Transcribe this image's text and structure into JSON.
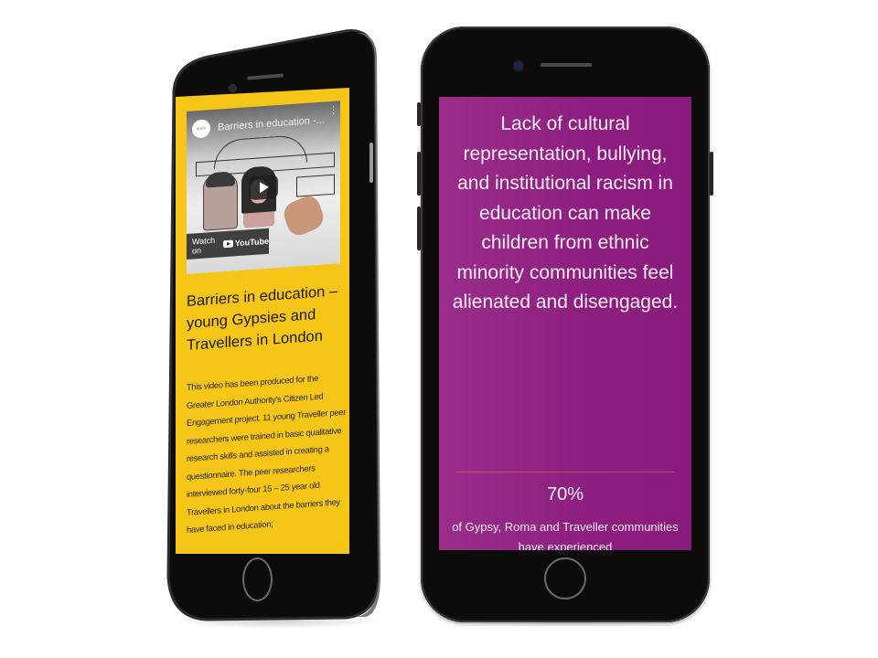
{
  "left_phone": {
    "video": {
      "title": "Barriers in education -...",
      "channel_logo_text": "ajefn",
      "menu_icon": "kebab-menu-icon",
      "play_icon": "play-icon",
      "watch_on_label": "Watch on",
      "youtube_label": "YouTube"
    },
    "title": "Barriers in education – young Gypsies and Travellers in London",
    "body": "This video has been produced for the Greater London Authority's Citizen Led Engagement project. 11 young Traveller peer researchers were trained in basic qualitative research skills and assisted in creating a questionnaire. The peer researchers interviewed forty-four 15 – 25 year old Travellers in London about the barriers they have faced in education;",
    "colors": {
      "background": "#f5c518",
      "text": "#1a1a1a"
    }
  },
  "right_phone": {
    "quote": "Lack of cultural representation, bullying, and institutional racism in education can make children from ethnic minority communities feel alienated and disengaged.",
    "stat": {
      "value": "70%",
      "description": "of Gypsy, Roma and Traveller communities have experienced"
    },
    "colors": {
      "background": "#8d1e80",
      "text": "#f4ecf3",
      "separator": "#c8505e"
    }
  }
}
